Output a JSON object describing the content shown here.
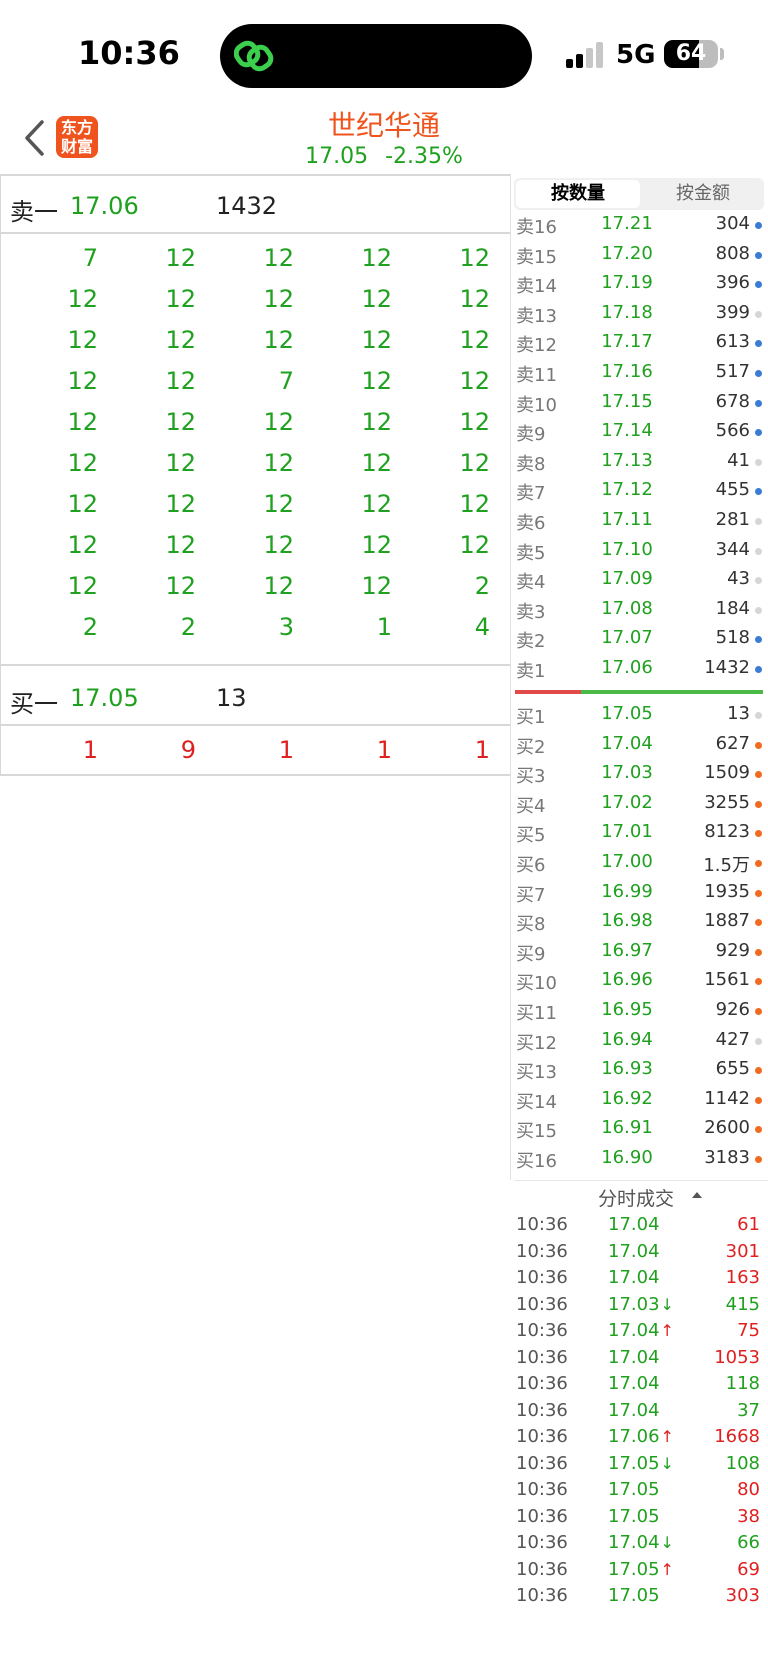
{
  "status": {
    "time": "10:36",
    "network": "5G",
    "battery": "64",
    "battery_level": 0.64
  },
  "header": {
    "brand_text": "东方\n财富",
    "title": "世纪华通",
    "price": "17.05",
    "change": "-2.35%"
  },
  "queue": {
    "sell_label": "卖一",
    "sell_price": "17.06",
    "sell_volume": "1432",
    "sell_orders": [
      [
        "7",
        "12",
        "12",
        "12",
        "12"
      ],
      [
        "12",
        "12",
        "12",
        "12",
        "12"
      ],
      [
        "12",
        "12",
        "12",
        "12",
        "12"
      ],
      [
        "12",
        "12",
        "7",
        "12",
        "12"
      ],
      [
        "12",
        "12",
        "12",
        "12",
        "12"
      ],
      [
        "12",
        "12",
        "12",
        "12",
        "12"
      ],
      [
        "12",
        "12",
        "12",
        "12",
        "12"
      ],
      [
        "12",
        "12",
        "12",
        "12",
        "12"
      ],
      [
        "12",
        "12",
        "12",
        "12",
        "2"
      ],
      [
        "2",
        "2",
        "3",
        "1",
        "4"
      ]
    ],
    "buy_label": "买一",
    "buy_price": "17.05",
    "buy_volume": "13",
    "buy_orders": [
      [
        "1",
        "9",
        "1",
        "1",
        "1"
      ]
    ]
  },
  "orderbook": {
    "tab_quantity": "按数量",
    "tab_amount": "按金额",
    "dot_colors": {
      "blue": "#3a7bd5",
      "grey": "#d6d6d6",
      "orange": "#f06a1f"
    },
    "asks": [
      {
        "label": "卖16",
        "price": "17.21",
        "volume": "304",
        "dot": "blue"
      },
      {
        "label": "卖15",
        "price": "17.20",
        "volume": "808",
        "dot": "blue"
      },
      {
        "label": "卖14",
        "price": "17.19",
        "volume": "396",
        "dot": "blue"
      },
      {
        "label": "卖13",
        "price": "17.18",
        "volume": "399",
        "dot": "grey"
      },
      {
        "label": "卖12",
        "price": "17.17",
        "volume": "613",
        "dot": "blue"
      },
      {
        "label": "卖11",
        "price": "17.16",
        "volume": "517",
        "dot": "blue"
      },
      {
        "label": "卖10",
        "price": "17.15",
        "volume": "678",
        "dot": "blue"
      },
      {
        "label": "卖9",
        "price": "17.14",
        "volume": "566",
        "dot": "blue"
      },
      {
        "label": "卖8",
        "price": "17.13",
        "volume": "41",
        "dot": "grey"
      },
      {
        "label": "卖7",
        "price": "17.12",
        "volume": "455",
        "dot": "blue"
      },
      {
        "label": "卖6",
        "price": "17.11",
        "volume": "281",
        "dot": "grey"
      },
      {
        "label": "卖5",
        "price": "17.10",
        "volume": "344",
        "dot": "grey"
      },
      {
        "label": "卖4",
        "price": "17.09",
        "volume": "43",
        "dot": "grey"
      },
      {
        "label": "卖3",
        "price": "17.08",
        "volume": "184",
        "dot": "grey"
      },
      {
        "label": "卖2",
        "price": "17.07",
        "volume": "518",
        "dot": "blue"
      },
      {
        "label": "卖1",
        "price": "17.06",
        "volume": "1432",
        "dot": "blue"
      }
    ],
    "bids": [
      {
        "label": "买1",
        "price": "17.05",
        "volume": "13",
        "dot": "grey"
      },
      {
        "label": "买2",
        "price": "17.04",
        "volume": "627",
        "dot": "orange"
      },
      {
        "label": "买3",
        "price": "17.03",
        "volume": "1509",
        "dot": "orange"
      },
      {
        "label": "买4",
        "price": "17.02",
        "volume": "3255",
        "dot": "orange"
      },
      {
        "label": "买5",
        "price": "17.01",
        "volume": "8123",
        "dot": "orange"
      },
      {
        "label": "买6",
        "price": "17.00",
        "volume": "1.5万",
        "dot": "orange"
      },
      {
        "label": "买7",
        "price": "16.99",
        "volume": "1935",
        "dot": "orange"
      },
      {
        "label": "买8",
        "price": "16.98",
        "volume": "1887",
        "dot": "orange"
      },
      {
        "label": "买9",
        "price": "16.97",
        "volume": "929",
        "dot": "orange"
      },
      {
        "label": "买10",
        "price": "16.96",
        "volume": "1561",
        "dot": "orange"
      },
      {
        "label": "买11",
        "price": "16.95",
        "volume": "926",
        "dot": "orange"
      },
      {
        "label": "买12",
        "price": "16.94",
        "volume": "427",
        "dot": "grey"
      },
      {
        "label": "买13",
        "price": "16.93",
        "volume": "655",
        "dot": "orange"
      },
      {
        "label": "买14",
        "price": "16.92",
        "volume": "1142",
        "dot": "orange"
      },
      {
        "label": "买15",
        "price": "16.91",
        "volume": "2600",
        "dot": "orange"
      },
      {
        "label": "买16",
        "price": "16.90",
        "volume": "3183",
        "dot": "orange"
      }
    ]
  },
  "trades": {
    "title": "分时成交",
    "rows": [
      {
        "time": "10:36",
        "price": "17.04",
        "dir": "",
        "volume": "61",
        "side": "buy"
      },
      {
        "time": "10:36",
        "price": "17.04",
        "dir": "",
        "volume": "301",
        "side": "buy"
      },
      {
        "time": "10:36",
        "price": "17.04",
        "dir": "",
        "volume": "163",
        "side": "buy"
      },
      {
        "time": "10:36",
        "price": "17.03",
        "dir": "down",
        "volume": "415",
        "side": "sell"
      },
      {
        "time": "10:36",
        "price": "17.04",
        "dir": "up",
        "volume": "75",
        "side": "buy"
      },
      {
        "time": "10:36",
        "price": "17.04",
        "dir": "",
        "volume": "1053",
        "side": "buy"
      },
      {
        "time": "10:36",
        "price": "17.04",
        "dir": "",
        "volume": "118",
        "side": "sell"
      },
      {
        "time": "10:36",
        "price": "17.04",
        "dir": "",
        "volume": "37",
        "side": "sell"
      },
      {
        "time": "10:36",
        "price": "17.06",
        "dir": "up",
        "volume": "1668",
        "side": "buy"
      },
      {
        "time": "10:36",
        "price": "17.05",
        "dir": "down",
        "volume": "108",
        "side": "sell"
      },
      {
        "time": "10:36",
        "price": "17.05",
        "dir": "",
        "volume": "80",
        "side": "buy"
      },
      {
        "time": "10:36",
        "price": "17.05",
        "dir": "",
        "volume": "38",
        "side": "buy"
      },
      {
        "time": "10:36",
        "price": "17.04",
        "dir": "down",
        "volume": "66",
        "side": "sell"
      },
      {
        "time": "10:36",
        "price": "17.05",
        "dir": "up",
        "volume": "69",
        "side": "buy"
      },
      {
        "time": "10:36",
        "price": "17.05",
        "dir": "",
        "volume": "303",
        "side": "buy"
      }
    ]
  }
}
